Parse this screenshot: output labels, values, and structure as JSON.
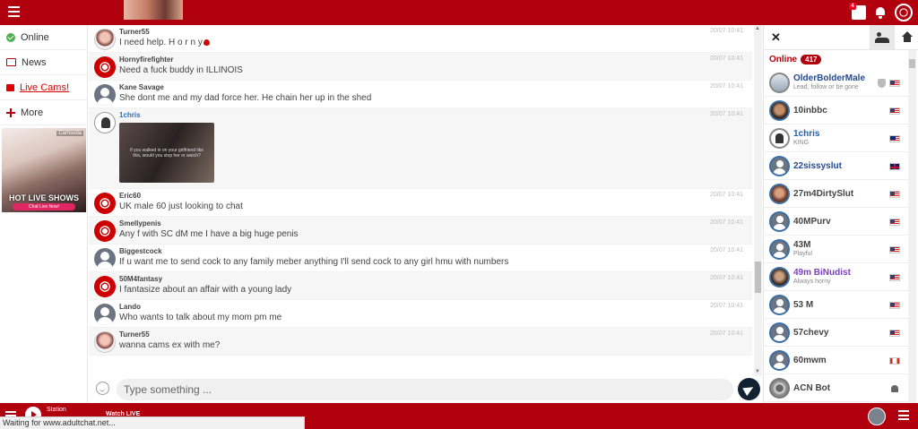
{
  "nav": {
    "items": [
      {
        "label": "Online"
      },
      {
        "label": "News"
      },
      {
        "label": "Live Cams!"
      },
      {
        "label": "More"
      }
    ]
  },
  "ad": {
    "headline": "HOT LIVE SHOWS",
    "button": "Chat Live Now!",
    "tag": "Camsoda"
  },
  "messages": [
    {
      "user": "Turner55",
      "text": "I need help. H o r n y",
      "time": "20/07 10:41",
      "avatar": "girl",
      "alt": false,
      "heart": true
    },
    {
      "user": "Hornyfirefighter",
      "text": "Need a fuck buddy in ILLINOIS",
      "time": "20/07 10:41",
      "avatar": "globe",
      "alt": true
    },
    {
      "user": "Kane Savage",
      "text": "She dont me and my dad force her. He chain her up in the shed",
      "time": "20/07 10:41",
      "avatar": "user",
      "alt": false
    },
    {
      "user": "1chris",
      "text": "",
      "time": "20/07 10:41",
      "avatar": "king",
      "alt": true,
      "image_caption": "If you walked in on your girlfriend like this, would you stop her or watch?"
    },
    {
      "user": "Eric60",
      "text": "UK male 60 just looking to chat",
      "time": "20/07 10:41",
      "avatar": "globe",
      "alt": false
    },
    {
      "user": "Smellypenis",
      "text": "Any f with SC dM me I have a big huge penis",
      "time": "20/07 10:41",
      "avatar": "globe",
      "alt": true
    },
    {
      "user": "Biggestcock",
      "text": "If u want me to send cock to any family meber anything I'll send cock to any girl hmu with numbers",
      "time": "20/07 10:41",
      "avatar": "user",
      "alt": false
    },
    {
      "user": "50M4fantasy",
      "text": "I fantasize about an affair with a young lady",
      "time": "20/07 10:41",
      "avatar": "globe",
      "alt": true
    },
    {
      "user": "Lando",
      "text": "Who wants to talk about my mom pm me",
      "time": "20/07 10:41",
      "avatar": "user",
      "alt": false
    },
    {
      "user": "Turner55",
      "text": "wanna cams ex with me?",
      "time": "20/07 10:41",
      "avatar": "girl",
      "alt": true
    }
  ],
  "input": {
    "placeholder": "Type something ..."
  },
  "online": {
    "label": "Online",
    "count": "417"
  },
  "users": [
    {
      "name": "OlderBolderMale",
      "sub": "Lead, follow or be gone",
      "flag": "us",
      "color": "c-navy",
      "av": "old",
      "shield": true
    },
    {
      "name": "10inbbc",
      "sub": "",
      "flag": "us",
      "color": "",
      "av": "ph1"
    },
    {
      "name": "1chris",
      "sub": "KING",
      "flag": "my",
      "color": "c-blue",
      "av": "k"
    },
    {
      "name": "22sissyslut",
      "sub": "",
      "flag": "gb",
      "color": "c-navy",
      "av": "u"
    },
    {
      "name": "27m4DirtySlut",
      "sub": "",
      "flag": "us",
      "color": "",
      "av": "ph2"
    },
    {
      "name": "40MPurv",
      "sub": "",
      "flag": "us",
      "color": "",
      "av": "u"
    },
    {
      "name": "43M",
      "sub": "Playful",
      "flag": "us",
      "color": "",
      "av": "u"
    },
    {
      "name": "49m BiNudist",
      "sub": "Always horny",
      "flag": "us",
      "color": "c-purple",
      "av": "ph3"
    },
    {
      "name": "53 M",
      "sub": "",
      "flag": "us",
      "color": "",
      "av": "u"
    },
    {
      "name": "57chevy",
      "sub": "",
      "flag": "us",
      "color": "",
      "av": "u"
    },
    {
      "name": "60mwm",
      "sub": "",
      "flag": "ca",
      "color": "",
      "av": "u"
    },
    {
      "name": "ACN Bot",
      "sub": "",
      "flag": "android",
      "color": "",
      "av": "gear"
    }
  ],
  "player": {
    "station": "Station",
    "watch": "Watch LIVE"
  },
  "status": {
    "text": "Waiting for www.adultchat.net..."
  },
  "colors": {
    "brand": "#b0000e",
    "accent": "#2c6fbf"
  }
}
